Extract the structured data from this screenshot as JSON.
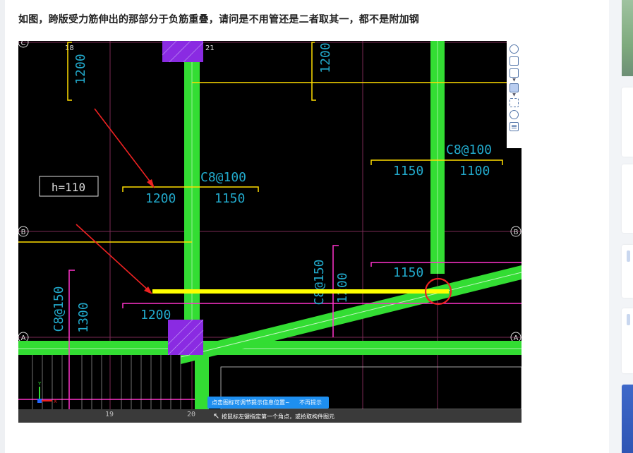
{
  "post": {
    "title": "如图，跨版受力筋伸出的那部分于负筋重叠，请问是不用管还是二者取其一，都不是附加钢"
  },
  "cad": {
    "axis_labels": {
      "C": "C",
      "B": "B",
      "A": "A"
    },
    "grid_numbers_top": [
      "18",
      "21"
    ],
    "grid_numbers_bottom": [
      "19",
      "20"
    ],
    "slab_label": "h=110",
    "rebar_labels": {
      "c8_100_mid": "C8@100",
      "c8_100_right": "C8@100",
      "c8_150_left": "C8@150",
      "c8_150_mid": "C8@150"
    },
    "dimensions": {
      "top_left_1200": "1200",
      "top_mid_1200": "1200",
      "mid_1200": "1200",
      "mid_1150": "1150",
      "right_1150": "1150",
      "right_1100": "1100",
      "right_low_1150": "1150",
      "low_1200": "1200",
      "left_1300": "1300",
      "mid_vert_1200": "1200"
    },
    "ucs": {
      "x": "X",
      "y": "Y"
    },
    "colors": {
      "background": "#000000",
      "wall_green": "#33dd33",
      "rebar_yellow": "#ffdd00",
      "highlight_yellow": "#ffff00",
      "rebar_magenta": "#ff33cc",
      "grid_line": "#7a2a55",
      "text_cyan": "#22aacc",
      "annotation_red": "#ee2222",
      "column_purple": "#8a2be2"
    }
  },
  "toolbar": {
    "icons": [
      "orbit-icon",
      "view-cube-icon",
      "box-3d-icon",
      "solid-box-icon",
      "zoom-extents-icon",
      "settings-icon",
      "notes-icon"
    ]
  },
  "hint": {
    "message": "点击图标可调节提示信息位置~",
    "dismiss": "不再提示"
  },
  "status": {
    "message": "按鼠标左键指定第一个角点，或拾取构件图元"
  }
}
